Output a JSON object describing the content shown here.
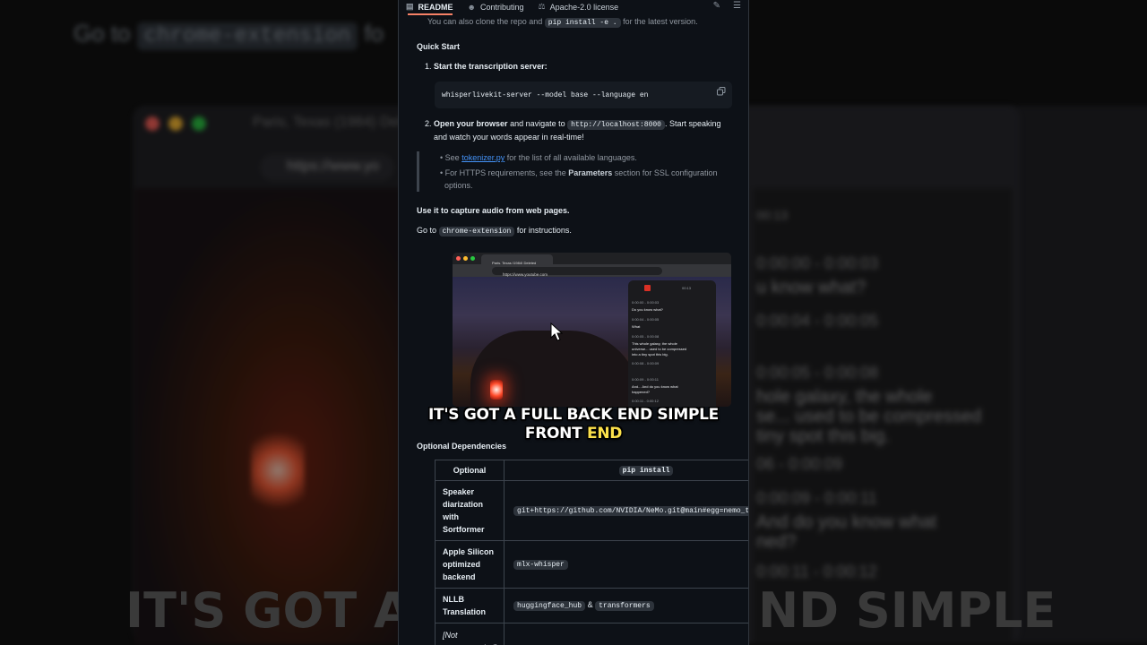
{
  "background": {
    "go_to": "Go to",
    "code": "chrome-extension",
    "trailing": "fo",
    "tab_title": "Paris, Texas (1984) Dele",
    "url": "https://www.yo",
    "timer": "00:13",
    "lines": [
      "0:00:00 - 0:00:03",
      "u know what?",
      "0:00:04 - 0:00:05",
      "0:00:05 - 0:00:08",
      "hole galaxy, the whole",
      "se... used to be compressed",
      "tiny spot this big.",
      "06 - 0:00:09",
      "0:00:09 - 0:00:11",
      "And do you know what",
      "ned?",
      "0:00:11 - 0:00:12"
    ],
    "caption_left": "IT'S GOT A",
    "caption_right": "ND SIMPLE"
  },
  "tabs": [
    {
      "label": "README",
      "icon": "book-icon",
      "active": true
    },
    {
      "label": "Contributing",
      "icon": "people-icon",
      "active": false
    },
    {
      "label": "Apache-2.0 license",
      "icon": "scale-icon",
      "active": false
    }
  ],
  "readme": {
    "clone_text_a": "You can also clone the repo and",
    "clone_code": "pip install -e .",
    "clone_text_b": "for the latest version.",
    "quick_start": "Quick Start",
    "step1_num": "1.",
    "step1": "Start the transcription server:",
    "command": "whisperlivekit-server --model base --language en",
    "step2_num": "2.",
    "step2_bold": "Open your browser",
    "step2_a": "and navigate to",
    "step2_code": "http://localhost:8000",
    "step2_b": ". Start speaking",
    "step2_c": "and watch your words appear in real-time!",
    "bullet1_pre": "See",
    "bullet1_link": "tokenizer.py",
    "bullet1_post": "for the list of all available languages.",
    "bullet2_pre": "For HTTPS requirements, see the",
    "bullet2_bold": "Parameters",
    "bullet2_post": "section for SSL configuration",
    "bullet2_cont": "options.",
    "capture_heading": "Use it to capture audio from web pages.",
    "goto_a": "Go to",
    "goto_code": "chrome-extension",
    "goto_b": "for instructions.",
    "optional_heading": "Optional Dependencies"
  },
  "screenshot": {
    "tab_title": "Paris, Texas (1984) Deleted",
    "url": "https://www.youtube.com",
    "timer": "00:13",
    "transcript": [
      {
        "time": "0:00:00 - 0:00:03",
        "text": "Do you know what?"
      },
      {
        "time": "0:00:04 - 0:00:05",
        "text": "What"
      },
      {
        "time": "0:00:05 - 0:00:08",
        "text": "This whole galaxy, the whole"
      },
      {
        "time": "",
        "text": "universe... used to be compressed"
      },
      {
        "time": "",
        "text": "into a tiny spot this big."
      },
      {
        "time": "0:00:08 - 0:00:09",
        "text": ""
      },
      {
        "time": "0:00:09 - 0:00:11",
        "text": "And... And do you know what"
      },
      {
        "time": "",
        "text": "happened?"
      },
      {
        "time": "0:00:11 - 0:00:12",
        "text": ""
      }
    ]
  },
  "caption": {
    "line1": "IT'S GOT A FULL BACK END SIMPLE",
    "line2_a": "FRONT",
    "line2_highlight": "END"
  },
  "table": {
    "headers": [
      "Optional",
      "pip install"
    ],
    "rows": [
      {
        "name": "Speaker diarization with Sortformer",
        "install": "git+https://github.com/NVIDIA/NeMo.git@main#egg=nemo_toolkit"
      },
      {
        "name": "Apple Silicon optimized backend",
        "install": "mlx-whisper"
      },
      {
        "name": "NLLB Translation",
        "install_a": "huggingface_hub",
        "amp": "&",
        "install_b": "transformers"
      },
      {
        "name": "[Not recommanded]",
        "install": ""
      }
    ]
  }
}
